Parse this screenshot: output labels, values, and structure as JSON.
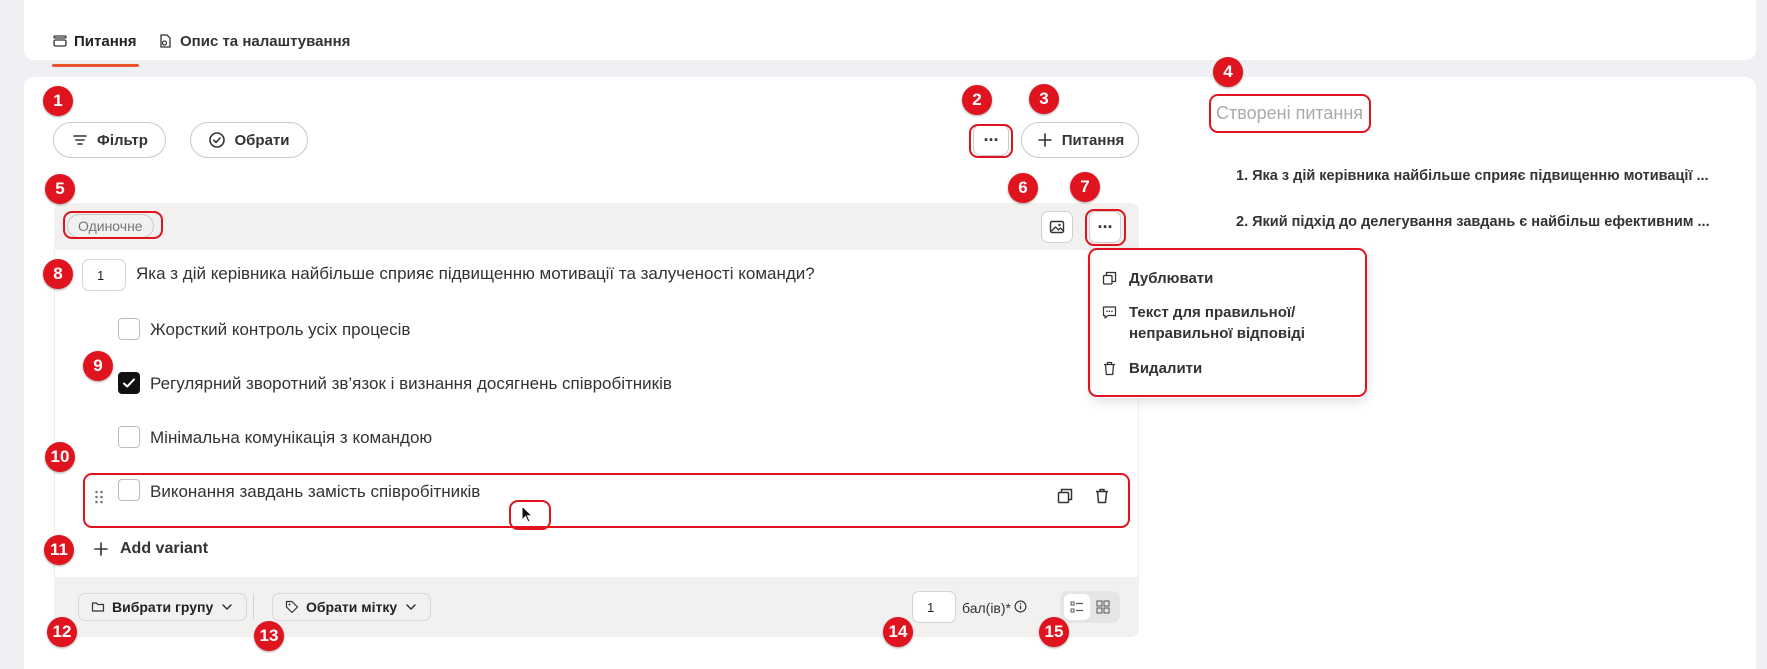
{
  "tabs": [
    {
      "label": "Питання",
      "active": true
    },
    {
      "label": "Опис та налаштування",
      "active": false
    }
  ],
  "toolbar": {
    "filter_label": "Фільтр",
    "select_label": "Обрати",
    "more_label": "···",
    "add_question_label": "Питання"
  },
  "question": {
    "type_tag": "Одиночне",
    "number": "1",
    "text": "Яка з дій керівника найбільше сприяє підвищенню мотивації та залученості команди?",
    "options": [
      {
        "text": "Жорсткий контроль усіх процесів",
        "checked": false
      },
      {
        "text": "Регулярний зворотний зв’язок і визнання досягнень співробітників",
        "checked": true
      },
      {
        "text": "Мінімальна комунікація з командою",
        "checked": false
      },
      {
        "text": "Виконання завдань замість співробітників",
        "checked": false
      }
    ],
    "add_variant_label": "Add variant",
    "more_label": "···"
  },
  "context_menu": {
    "duplicate": "Дублювати",
    "answer_text_line1": "Текст для правильної/",
    "answer_text_line2": "неправильної відповіді",
    "delete": "Видалити"
  },
  "footer": {
    "group_label": "Вибрати групу",
    "tag_label": "Обрати мітку",
    "points_value": "1",
    "points_unit": "бал(ів)*"
  },
  "sidebar": {
    "title": "Створені питання",
    "items": [
      "1. Яка з дій керівника найбільше сприяє підвищенню мотивації ...",
      "2. Який підхід до делегування завдань є найбільш ефективним ..."
    ]
  },
  "annotations": [
    "1",
    "2",
    "3",
    "4",
    "5",
    "6",
    "7",
    "8",
    "9",
    "10",
    "11",
    "12",
    "13",
    "14",
    "15"
  ],
  "colors": {
    "accent": "#e8542c",
    "annotation_red": "#e0141e",
    "panel_gray": "#f2f1f0",
    "background": "#eef0f4"
  }
}
